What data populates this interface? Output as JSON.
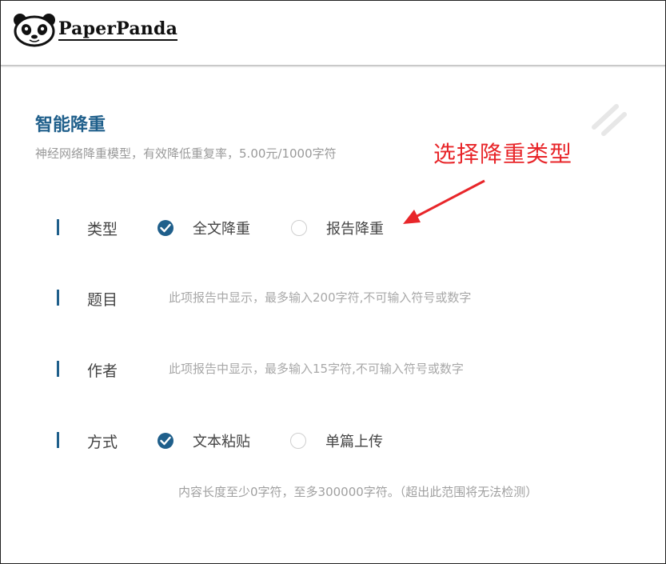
{
  "brand": {
    "name": "PaperPanda"
  },
  "section": {
    "title": "智能降重",
    "description": "神经网络降重模型，有效降低重复率，5.00元/1000字符"
  },
  "annotation": {
    "text": "选择降重类型",
    "color": "#e8262a"
  },
  "form": {
    "type": {
      "label": "类型",
      "options": [
        {
          "label": "全文降重",
          "checked": true
        },
        {
          "label": "报告降重",
          "checked": false
        }
      ]
    },
    "title": {
      "label": "题目",
      "placeholder": "此项报告中显示，最多输入200字符,不可输入符号或数字"
    },
    "author": {
      "label": "作者",
      "placeholder": "此项报告中显示，最多输入15字符,不可输入符号或数字"
    },
    "method": {
      "label": "方式",
      "options": [
        {
          "label": "文本粘贴",
          "checked": true
        },
        {
          "label": "单篇上传",
          "checked": false
        }
      ]
    },
    "hint": "内容长度至少0字符，至多300000字符。（超出此范围将无法检测）"
  },
  "colors": {
    "accent": "#1f5f8b",
    "muted": "#9a9a9a"
  },
  "icons": {
    "logo": "panda-icon",
    "checked": "check-icon",
    "annotation_arrow": "arrow-icon"
  }
}
